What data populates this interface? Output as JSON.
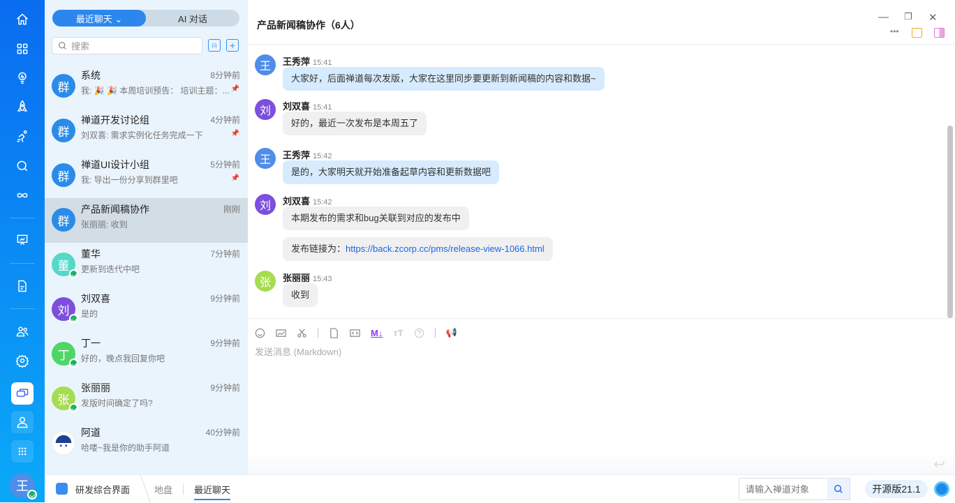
{
  "rail": {
    "items": [
      "home",
      "apps",
      "idea",
      "rocket",
      "sprint",
      "search",
      "devops",
      "report",
      "doc",
      "team",
      "settings",
      "chat",
      "contacts",
      "more"
    ],
    "user_initial": "王"
  },
  "list": {
    "tabs": [
      {
        "label": "最近聊天 ⌄"
      },
      {
        "label": "AI 对话"
      }
    ],
    "search_placeholder": "搜索",
    "chats": [
      {
        "avatar": "群",
        "name": "系统",
        "time": "8分钟前",
        "preview": "我: 🎉 🎉 本周培训预告： 培训主题：...",
        "pinned": true,
        "color": "#2b8be8"
      },
      {
        "avatar": "群",
        "name": "禅道开发讨论组",
        "time": "4分钟前",
        "preview": "刘双喜: 需求实例化任务完成一下",
        "pinned": true,
        "color": "#2b8be8"
      },
      {
        "avatar": "群",
        "name": "禅道UI设计小组",
        "time": "5分钟前",
        "preview": "我: 导出一份分享到群里吧",
        "pinned": true,
        "color": "#2b8be8"
      },
      {
        "avatar": "群",
        "name": "产品新闻稿协作",
        "time": "刚刚",
        "preview": "张丽丽: 收到",
        "pinned": false,
        "color": "#2b8be8"
      },
      {
        "avatar": "董",
        "name": "董华",
        "time": "7分钟前",
        "preview": "更新到迭代中吧",
        "online": true,
        "color": "#55d8c8"
      },
      {
        "avatar": "刘",
        "name": "刘双喜",
        "time": "9分钟前",
        "preview": "是的",
        "online": true,
        "color": "#7c4fdc"
      },
      {
        "avatar": "丁",
        "name": "丁一",
        "time": "9分钟前",
        "preview": "好的，晚点我回复你吧",
        "online": true,
        "color": "#4fd668"
      },
      {
        "avatar": "张",
        "name": "张丽丽",
        "time": "9分钟前",
        "preview": "发版时间确定了吗?",
        "online": true,
        "color": "#a5dc52"
      },
      {
        "avatar": "",
        "name": "阿道",
        "time": "40分钟前",
        "preview": "哈喽~我是你的助手阿道",
        "color": "#ffffff"
      }
    ]
  },
  "chat": {
    "title": "产品新闻稿协作（6人）",
    "messages": [
      {
        "avatar": "王",
        "sender": "王秀萍",
        "time": "15:41",
        "text": "大家好，后面禅道每次发版，大家在这里同步要更新到新闻稿的内容和数据~",
        "mine": true,
        "color": "#4f8de8"
      },
      {
        "avatar": "刘",
        "sender": "刘双喜",
        "time": "15:41",
        "text": "好的，最近一次发布是本周五了",
        "color": "#7c4fdc"
      },
      {
        "avatar": "王",
        "sender": "王秀萍",
        "time": "15:42",
        "text": "是的，大家明天就开始准备起草内容和更新数据吧",
        "mine": true,
        "color": "#4f8de8"
      },
      {
        "avatar": "刘",
        "sender": "刘双喜",
        "time": "15:42",
        "text": "本期发布的需求和bug关联到对应的发布中",
        "color": "#7c4fdc"
      },
      {
        "text_prefix": "发布链接为：",
        "link": "https://back.zcorp.cc/pms/release-view-1066.html"
      },
      {
        "avatar": "张",
        "sender": "张丽丽",
        "time": "15:43",
        "text": "收到",
        "color": "#a5dc52"
      }
    ],
    "editor_placeholder": "发送消息 (Markdown)",
    "md_label": "M↓"
  },
  "footer": {
    "app": "研发综合界面",
    "crumbs": [
      "地盘",
      "最近聊天"
    ],
    "search_placeholder": "请输入禅道对象",
    "version": "开源版21.1"
  }
}
